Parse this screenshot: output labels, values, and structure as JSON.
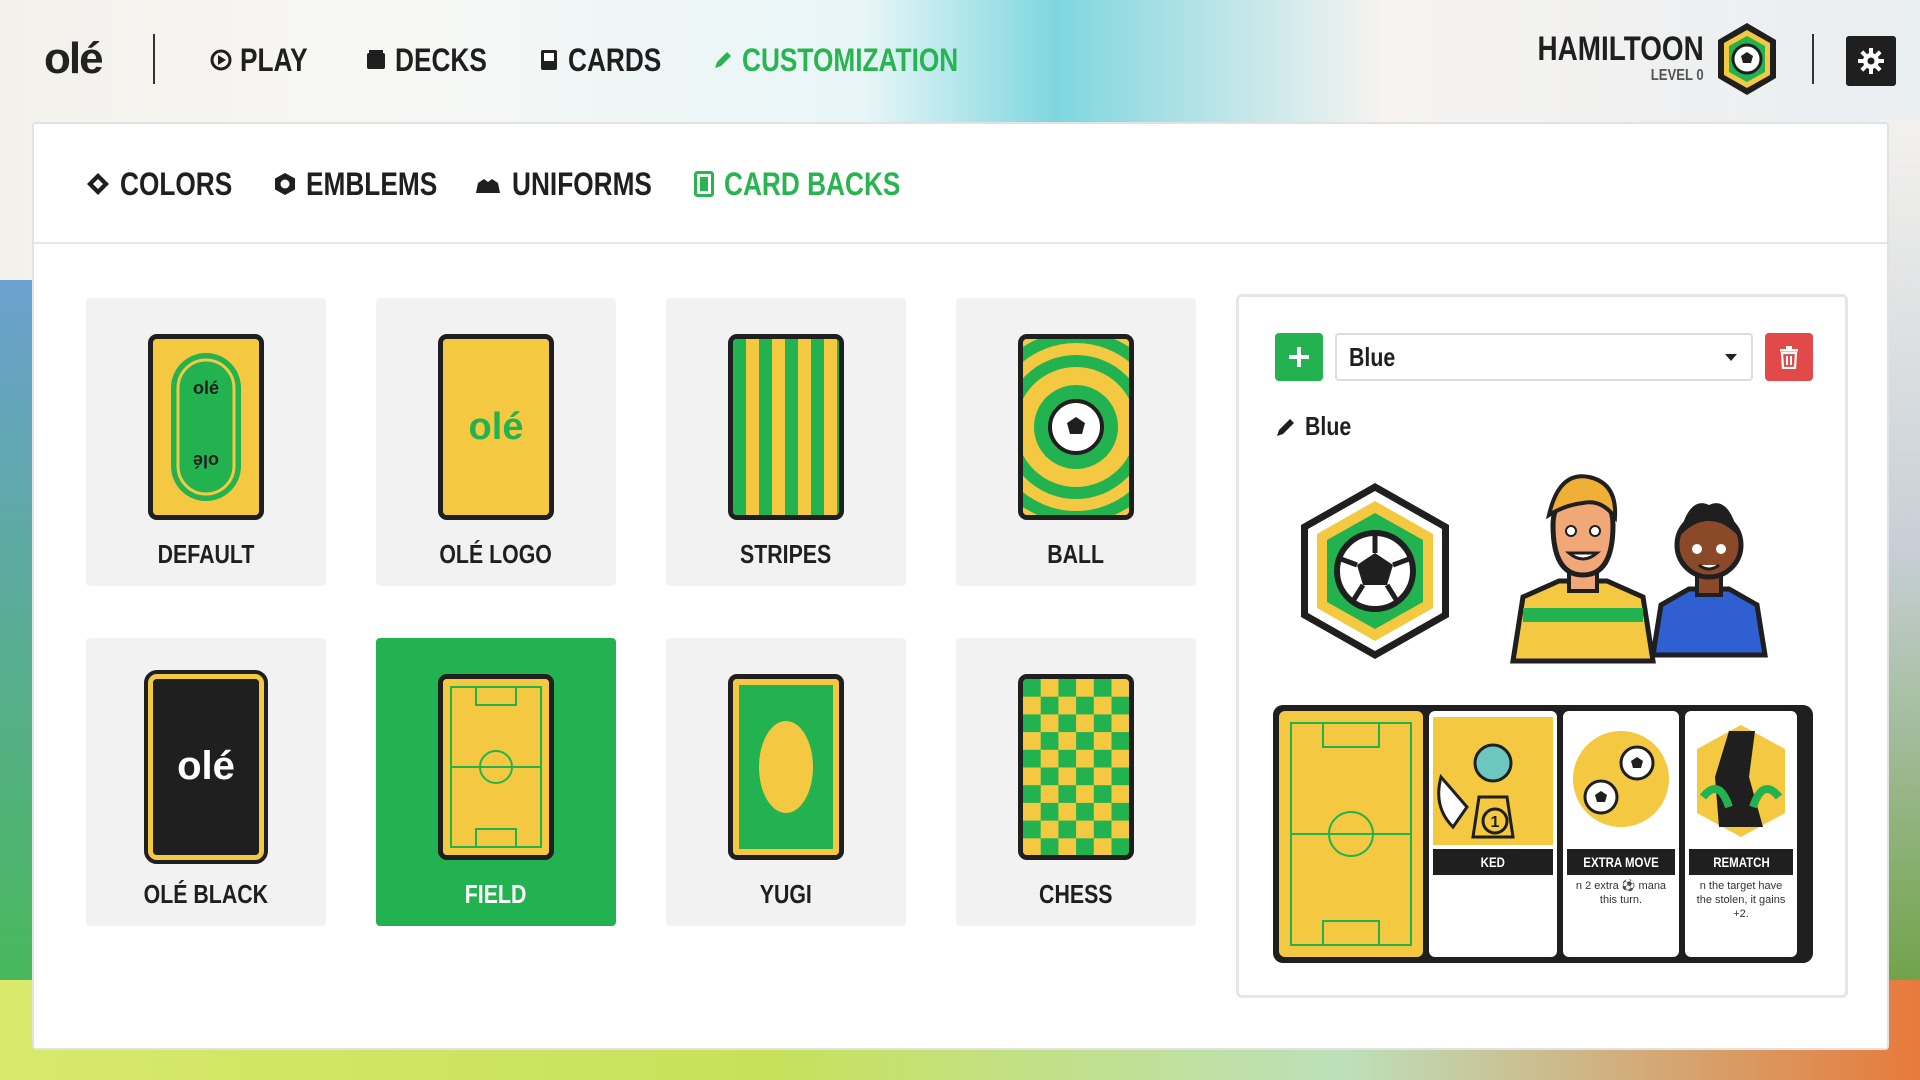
{
  "app": {
    "logo": "olé"
  },
  "nav": {
    "items": [
      {
        "label": "PLAY",
        "icon": "play-icon"
      },
      {
        "label": "DECKS",
        "icon": "decks-icon"
      },
      {
        "label": "CARDS",
        "icon": "card-icon"
      },
      {
        "label": "CUSTOMIZATION",
        "icon": "pencil-icon",
        "active": true
      }
    ]
  },
  "user": {
    "name": "HAMILTOON",
    "level": "LEVEL 0",
    "badge_icon": "soccer-ball-hex-icon"
  },
  "settings": {
    "icon": "gear-icon"
  },
  "subnav": {
    "items": [
      {
        "label": "COLORS",
        "icon": "diamond-icon"
      },
      {
        "label": "EMBLEMS",
        "icon": "hexagon-icon"
      },
      {
        "label": "UNIFORMS",
        "icon": "shirt-icon"
      },
      {
        "label": "CARD BACKS",
        "icon": "card-back-icon",
        "active": true
      }
    ]
  },
  "card_backs": [
    {
      "label": "DEFAULT"
    },
    {
      "label": "OLÉ LOGO"
    },
    {
      "label": "STRIPES"
    },
    {
      "label": "BALL"
    },
    {
      "label": "OLÉ BLACK"
    },
    {
      "label": "FIELD",
      "selected": true
    },
    {
      "label": "YUGI"
    },
    {
      "label": "CHESS"
    }
  ],
  "colors": {
    "green": "#22b350",
    "yellow": "#f5c842",
    "dark": "#1f1f1f",
    "red": "#e24a4a",
    "blue": "#2f5fd0"
  },
  "preview": {
    "preset_value": "Blue",
    "name_label": "Blue",
    "cards": [
      {
        "title": "KED",
        "desc": ""
      },
      {
        "title": "EXTRA MOVE",
        "desc": "n 2 extra ⚽ mana this turn."
      },
      {
        "title": "REMATCH",
        "desc": "n the target have the stolen, it gains +2."
      }
    ]
  }
}
